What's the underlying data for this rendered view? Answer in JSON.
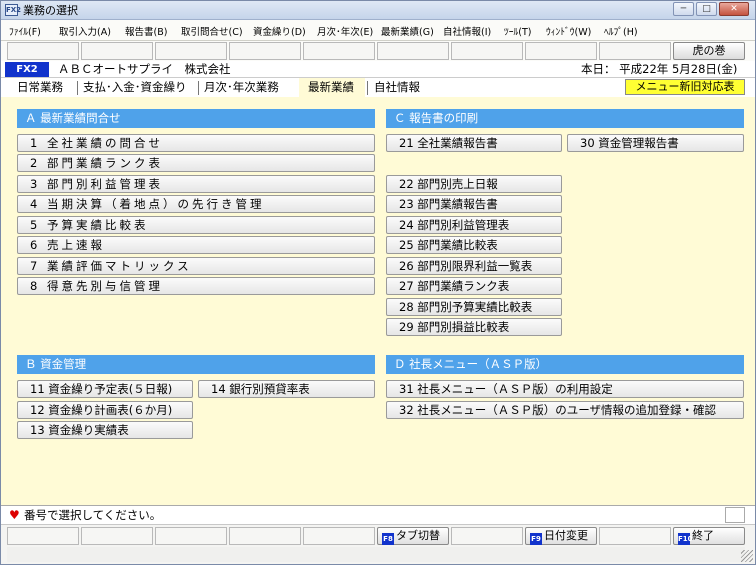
{
  "window": {
    "title": "業務の選択",
    "app_icon": "FX2",
    "btn_min": "─",
    "btn_max": "□",
    "btn_close": "✕"
  },
  "menubar": [
    {
      "label": "ﾌｧｲﾙ(F)"
    },
    {
      "label": "取引入力(A)"
    },
    {
      "label": "報告書(B)"
    },
    {
      "label": "取引問合せ(C)"
    },
    {
      "label": "資金繰り(D)"
    },
    {
      "label": "月次･年次(E)"
    },
    {
      "label": "最新業績(G)"
    },
    {
      "label": "自社情報(I)"
    },
    {
      "label": "ﾂｰﾙ(T)"
    },
    {
      "label": "ｳｨﾝﾄﾞｳ(W)"
    },
    {
      "label": "ﾍﾙﾌﾟ(H)"
    }
  ],
  "toolbar": {
    "tora_label": "虎の巻"
  },
  "info": {
    "badge": "FX2",
    "company": "ＡＢＣオートサプライ　株式会社",
    "date": "本日： 平成22年 5月28日(金)"
  },
  "tabs": [
    {
      "label": "日常業務"
    },
    {
      "label": "支払･入金･資金繰り"
    },
    {
      "label": "月次･年次業務"
    },
    {
      "label": "最新業績"
    },
    {
      "label": "自社情報"
    }
  ],
  "notice": "メニュー新旧対応表",
  "sections": {
    "A": {
      "title": "Ａ 最新業績問合せ",
      "items": [
        "1 全社業績の問合せ",
        "2 部門業績ランク表",
        "3 部門別利益管理表",
        "4 当期決算（着地点）の先行き管理",
        "5 予算実績比較表",
        "6 売上速報",
        "7 業績評価マトリックス",
        "8 得意先別与信管理"
      ]
    },
    "B": {
      "title": "Ｂ 資金管理",
      "items": [
        "11 資金繰り予定表(５日報)",
        "12 資金繰り計画表(６か月)",
        "13 資金繰り実績表",
        "14 銀行別預貸率表"
      ]
    },
    "C": {
      "title": "Ｃ 報告書の印刷",
      "items": [
        "21 全社業績報告書",
        "30 資金管理報告書",
        "22 部門別売上日報",
        "23 部門業績報告書",
        "24 部門別利益管理表",
        "25 部門業績比較表",
        "26 部門別限界利益一覧表",
        "27 部門業績ランク表",
        "28 部門別予算実績比較表",
        "29 部門別損益比較表"
      ]
    },
    "D": {
      "title": "Ｄ 社長メニュー（ＡＳＰ版）",
      "items": [
        "31 社長メニュー（ＡＳＰ版）の利用設定",
        "32 社長メニュー（ＡＳＰ版）のユーザ情報の追加登録・確認"
      ]
    }
  },
  "status": {
    "heart": "♥",
    "message": "番号で選択してください。"
  },
  "bottom": {
    "tab_switch": {
      "key": "F8",
      "label": "タブ切替"
    },
    "date_change": {
      "key": "F9",
      "label": "日付変更"
    },
    "exit": {
      "key": "F10",
      "label": "終了"
    }
  }
}
